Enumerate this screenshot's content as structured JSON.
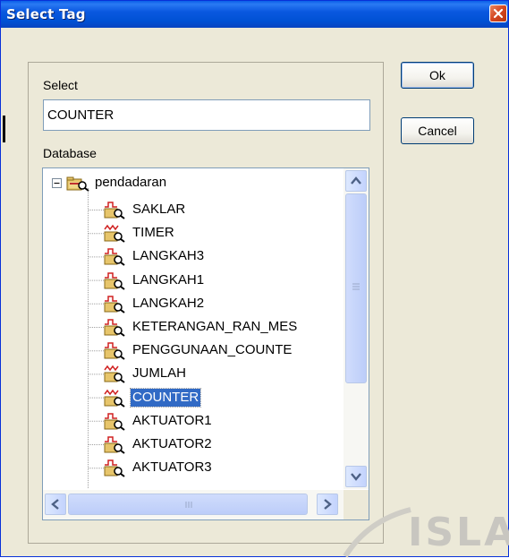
{
  "window": {
    "title": "Select Tag"
  },
  "select": {
    "label": "Select",
    "value": "COUNTER"
  },
  "database": {
    "label": "Database"
  },
  "buttons": {
    "ok": "Ok",
    "cancel": "Cancel"
  },
  "tree": {
    "root": "pendadaran",
    "items": [
      {
        "label": "SAKLAR",
        "icon": "digital-tag-icon"
      },
      {
        "label": "TIMER",
        "icon": "analog-tag-icon"
      },
      {
        "label": "LANGKAH3",
        "icon": "digital-tag-icon"
      },
      {
        "label": "LANGKAH1",
        "icon": "digital-tag-icon"
      },
      {
        "label": "LANGKAH2",
        "icon": "digital-tag-icon"
      },
      {
        "label": "KETERANGAN_RAN_MES",
        "icon": "digital-tag-icon"
      },
      {
        "label": "PENGGUNAAN_COUNTE",
        "icon": "digital-tag-icon"
      },
      {
        "label": "JUMLAH",
        "icon": "analog-tag-icon"
      },
      {
        "label": "COUNTER",
        "icon": "analog-tag-icon",
        "selected": true
      },
      {
        "label": "AKTUATOR1",
        "icon": "digital-tag-icon"
      },
      {
        "label": "AKTUATOR2",
        "icon": "digital-tag-icon"
      },
      {
        "label": "AKTUATOR3",
        "icon": "digital-tag-icon"
      }
    ]
  },
  "watermark": "ISLA",
  "colors": {
    "title_bar": "#0a58e0",
    "selection": "#316ac5",
    "dialog_bg": "#ece9d8"
  }
}
